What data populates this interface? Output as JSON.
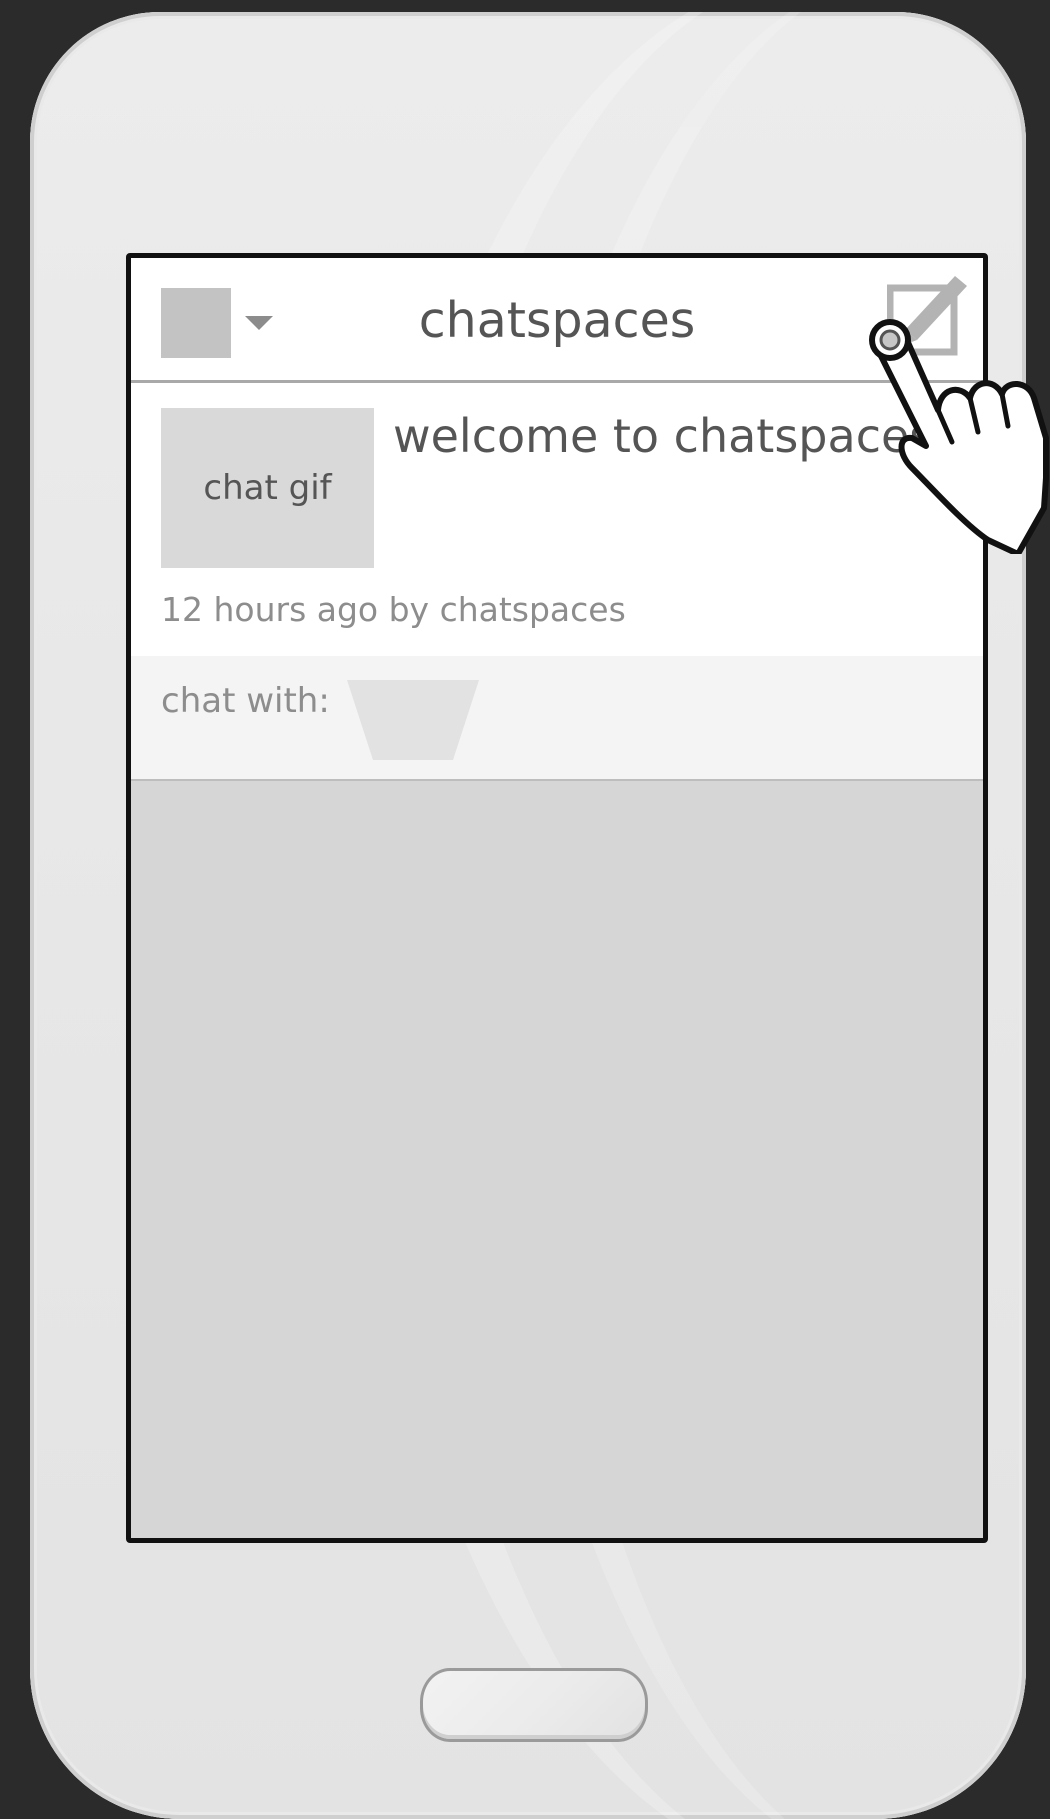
{
  "app": {
    "title": "chatspaces"
  },
  "header": {
    "menu_icon": "menu-square-icon",
    "dropdown_icon": "caret-down-icon",
    "compose_icon": "compose-edit-icon"
  },
  "post": {
    "thumbnail_label": "chat gif",
    "title": "welcome to chatspaces!",
    "meta": "12 hours ago by chatspaces"
  },
  "chat_with": {
    "label": "chat with:",
    "selector_icon": "funnel-placeholder-icon"
  },
  "device": {
    "home_button_icon": "home-button-icon",
    "pointer_icon": "hand-pointer-icon"
  }
}
